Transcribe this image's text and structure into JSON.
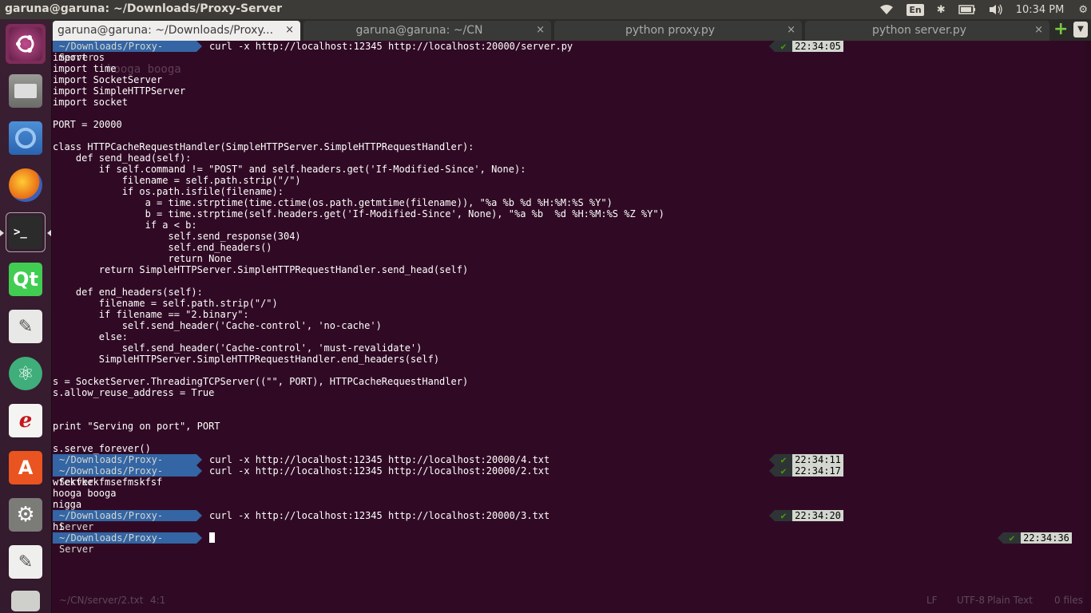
{
  "top_panel": {
    "window_title": "garuna@garuna: ~/Downloads/Proxy-Server",
    "keyboard": "En",
    "clock": "10:34 PM"
  },
  "launcher": {
    "items": [
      "ubuntu-dash-icon",
      "files-icon",
      "chromium-icon",
      "firefox-icon",
      "terminal-icon",
      "qt-creator-icon",
      "text-editor-icon",
      "atom-icon",
      "pdf-viewer-icon",
      "software-center-icon",
      "system-settings-icon",
      "gedit-icon",
      "trash-icon"
    ]
  },
  "tabs": [
    {
      "label": "garuna@garuna: ~/Downloads/Proxy...",
      "close": "×",
      "active": true
    },
    {
      "label": "garuna@garuna: ~/CN",
      "close": "×",
      "active": false
    },
    {
      "label": "python proxy.py",
      "close": "×",
      "active": false
    },
    {
      "label": "python server.py",
      "close": "×",
      "active": false
    }
  ],
  "tab_actions": {
    "new_tab": "+",
    "menu": "▼"
  },
  "terminal": {
    "prompt_dir": "~/Downloads/Proxy-Server",
    "check": "✔",
    "commands": [
      {
        "cmd": "curl -x http://localhost:12345 http://localhost:20000/server.py",
        "time": "22:34:05"
      },
      {
        "cmd": "curl -x http://localhost:12345 http://localhost:20000/4.txt",
        "time": "22:34:11"
      },
      {
        "cmd": "curl -x http://localhost:12345 http://localhost:20000/2.txt",
        "time": "22:34:17"
      },
      {
        "cmd": "curl -x http://localhost:12345 http://localhost:20000/3.txt",
        "time": "22:34:20"
      },
      {
        "cmd": "",
        "time": "22:34:36"
      }
    ],
    "output_server_py": [
      "import os",
      "import time",
      "import SocketServer",
      "import SimpleHTTPServer",
      "import socket",
      "",
      "PORT = 20000",
      "",
      "class HTTPCacheRequestHandler(SimpleHTTPServer.SimpleHTTPRequestHandler):",
      "    def send_head(self):",
      "        if self.command != \"POST\" and self.headers.get('If-Modified-Since', None):",
      "            filename = self.path.strip(\"/\")",
      "            if os.path.isfile(filename):",
      "                a = time.strptime(time.ctime(os.path.getmtime(filename)), \"%a %b %d %H:%M:%S %Y\")",
      "                b = time.strptime(self.headers.get('If-Modified-Since', None), \"%a %b  %d %H:%M:%S %Z %Y\")",
      "                if a < b:",
      "                    self.send_response(304)",
      "                    self.end_headers()",
      "                    return None",
      "        return SimpleHTTPServer.SimpleHTTPRequestHandler.send_head(self)",
      "",
      "    def end_headers(self):",
      "        filename = self.path.strip(\"/\")",
      "        if filename == \"2.binary\":",
      "            self.send_header('Cache-control', 'no-cache')",
      "        else:",
      "            self.send_header('Cache-control', 'must-revalidate')",
      "        SimpleHTTPServer.SimpleHTTPRequestHandler.end_headers(self)",
      "",
      "s = SocketServer.ThreadingTCPServer((\"\", PORT), HTTPCacheRequestHandler)",
      "s.allow_reuse_address = True",
      "",
      "",
      "print \"Serving on port\", PORT",
      "",
      "s.serve_forever()"
    ],
    "output_2_txt": [
      "wfekfkekfmsefmskfsf",
      "hooga booga",
      "nigga"
    ],
    "output_3_txt": [
      "hi"
    ],
    "ghost_text": "hooga booga"
  },
  "statusbar": {
    "path": "~/CN/server/2.txt",
    "position": "4:1",
    "line_ending": "LF",
    "encoding": "UTF-8",
    "syntax": "Plain Text",
    "files": "0 files"
  }
}
